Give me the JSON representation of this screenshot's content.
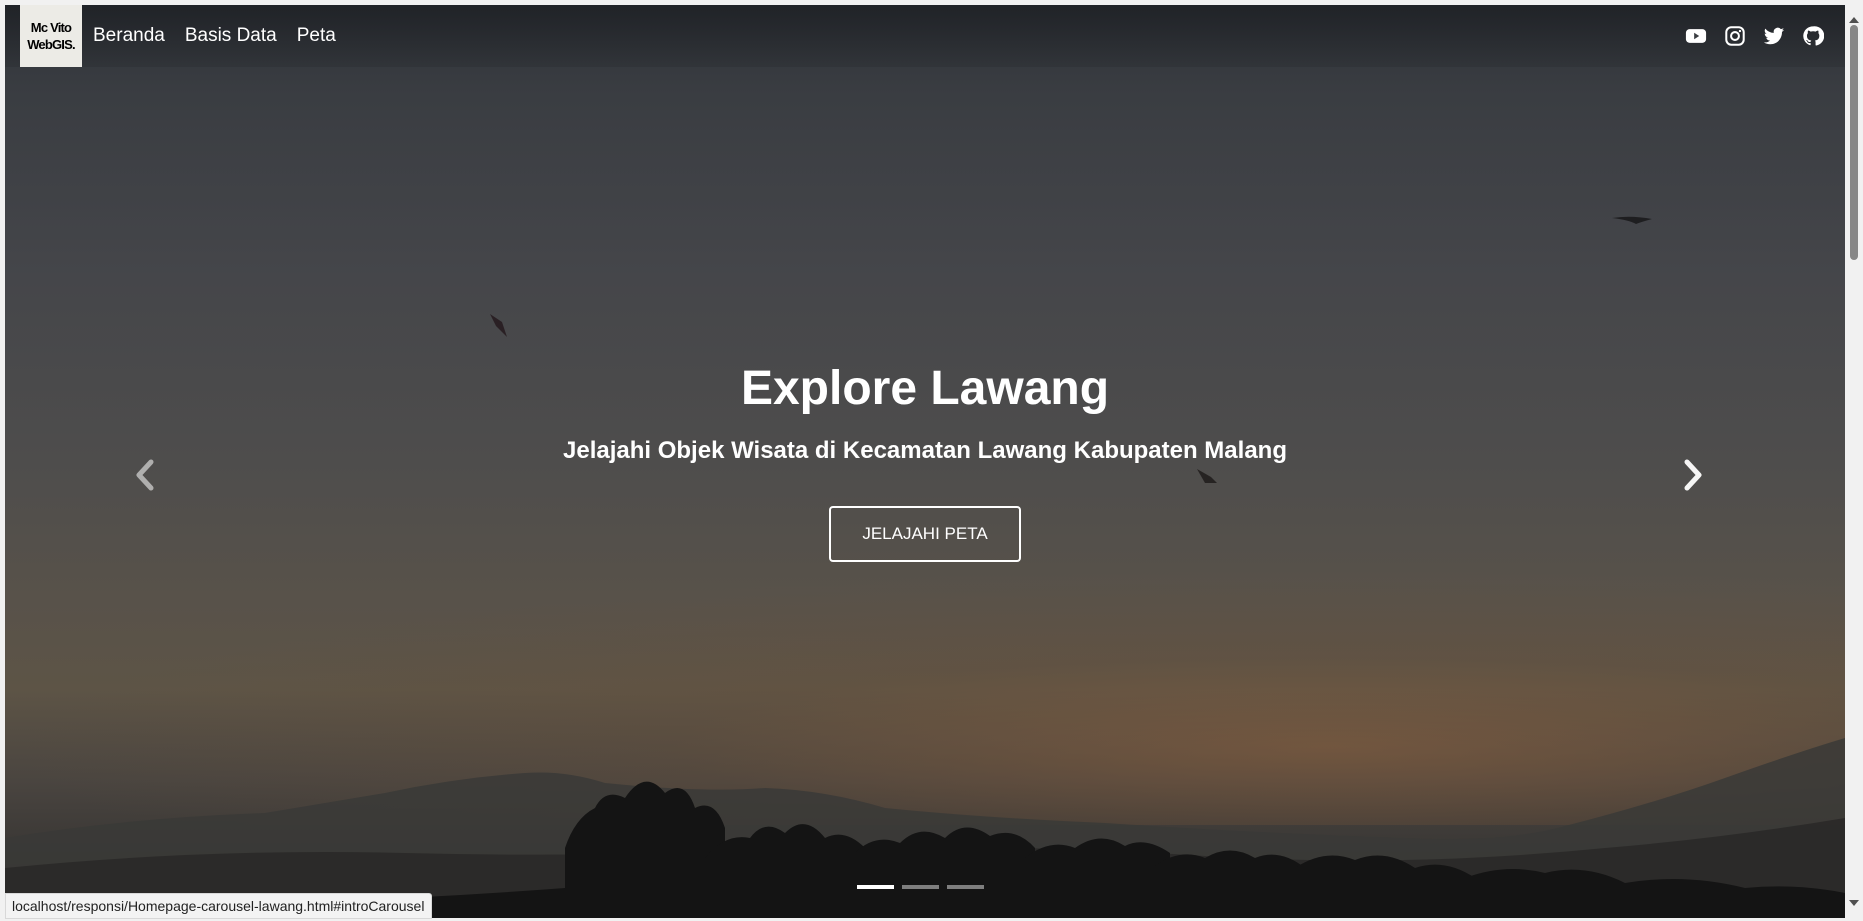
{
  "brand": {
    "line1": "Mc Vito",
    "line2": "WebGIS."
  },
  "nav": {
    "items": [
      {
        "label": "Beranda"
      },
      {
        "label": "Basis Data"
      },
      {
        "label": "Peta"
      }
    ]
  },
  "social": {
    "icons": [
      "youtube-icon",
      "instagram-icon",
      "twitter-icon",
      "github-icon"
    ]
  },
  "hero": {
    "title": "Explore Lawang",
    "subtitle": "Jelajahi Objek Wisata di Kecamatan Lawang Kabupaten Malang",
    "button_label": "JELAJAHI PETA"
  },
  "carousel": {
    "slide_count": 3,
    "active_index": 0
  },
  "status_bar": {
    "url": "localhost/responsi/Homepage-carousel-lawang.html#introCarousel"
  },
  "colors": {
    "text": "#ffffff",
    "brand_bg": "#ecebe6"
  }
}
